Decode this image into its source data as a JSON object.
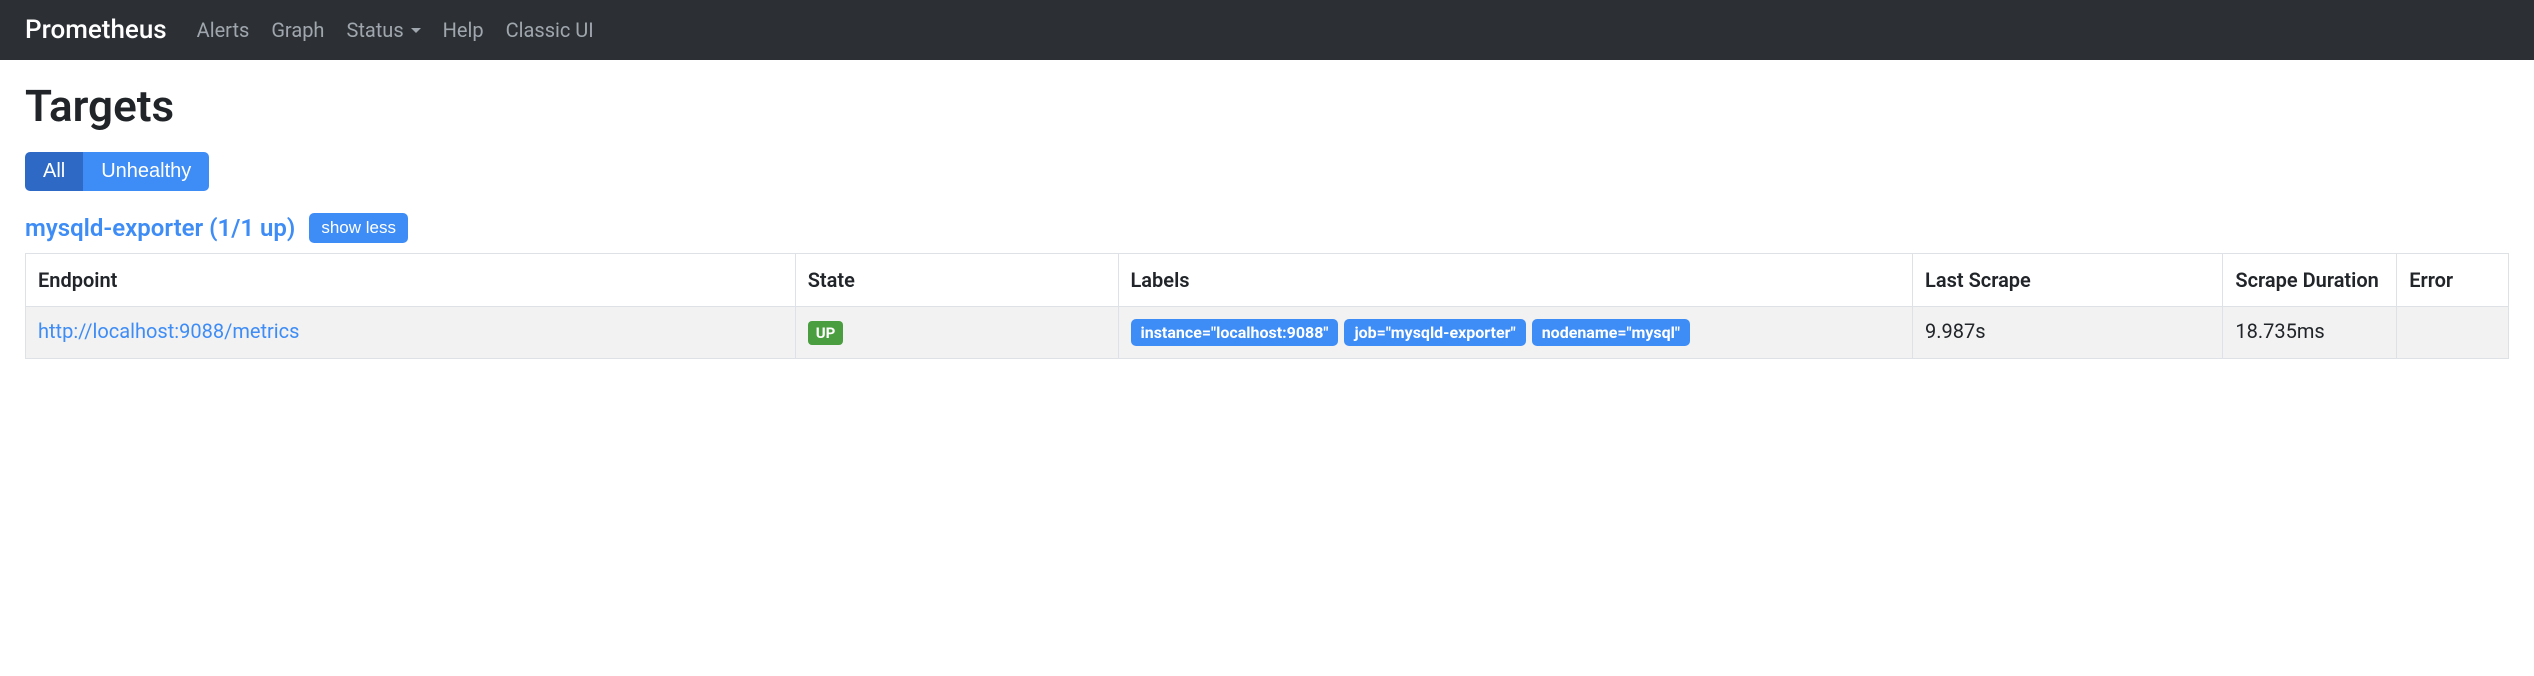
{
  "navbar": {
    "brand": "Prometheus",
    "links": {
      "alerts": "Alerts",
      "graph": "Graph",
      "status": "Status",
      "help": "Help",
      "classic": "Classic UI"
    }
  },
  "page": {
    "title": "Targets"
  },
  "filters": {
    "all": "All",
    "unhealthy": "Unhealthy"
  },
  "job": {
    "title": "mysqld-exporter (1/1 up)",
    "toggle_button": "show less"
  },
  "table": {
    "headers": {
      "endpoint": "Endpoint",
      "state": "State",
      "labels": "Labels",
      "last_scrape": "Last Scrape",
      "scrape_duration": "Scrape Duration",
      "error": "Error"
    },
    "rows": [
      {
        "endpoint": "http://localhost:9088/metrics",
        "state": "UP",
        "labels": [
          "instance=\"localhost:9088\"",
          "job=\"mysqld-exporter\"",
          "nodename=\"mysql\""
        ],
        "last_scrape": "9.987s",
        "scrape_duration": "18.735ms",
        "error": ""
      }
    ]
  }
}
